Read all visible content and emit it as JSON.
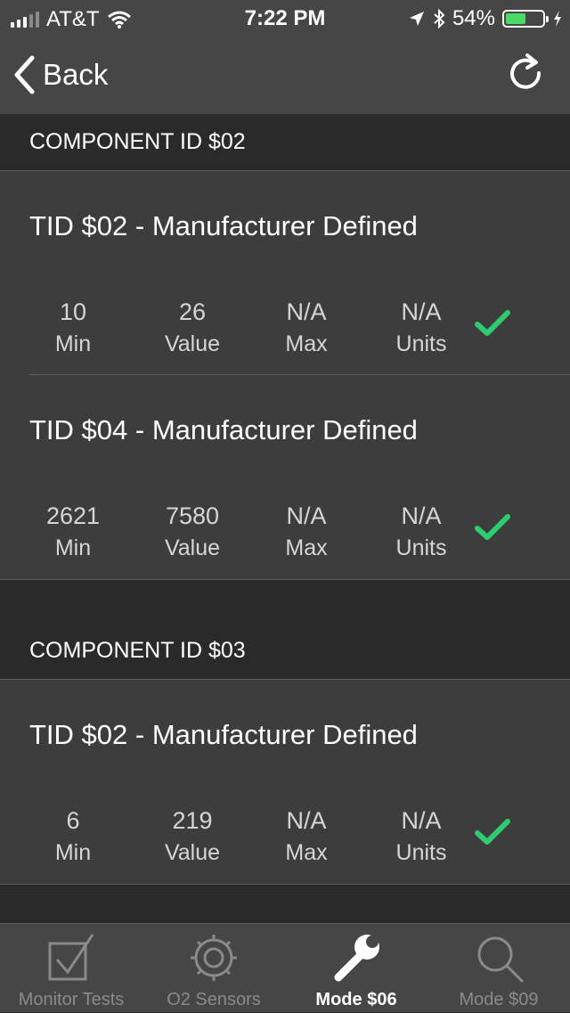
{
  "status_bar": {
    "carrier": "AT&T",
    "time": "7:22 PM",
    "battery_percent": "54%",
    "battery_level": 0.54,
    "icons": [
      "signal-icon",
      "wifi-icon",
      "location-icon",
      "bluetooth-icon",
      "battery-icon",
      "charging-icon"
    ]
  },
  "nav": {
    "back_label": "Back",
    "refresh_icon": "refresh-icon"
  },
  "sections": [
    {
      "title": "COMPONENT ID $02",
      "tests": [
        {
          "title": "TID $02 - Manufacturer Defined",
          "min": "10",
          "value": "26",
          "max": "N/A",
          "units": "N/A",
          "min_label": "Min",
          "value_label": "Value",
          "max_label": "Max",
          "units_label": "Units",
          "passed": true
        },
        {
          "title": "TID $04 - Manufacturer Defined",
          "min": "2621",
          "value": "7580",
          "max": "N/A",
          "units": "N/A",
          "min_label": "Min",
          "value_label": "Value",
          "max_label": "Max",
          "units_label": "Units",
          "passed": true
        }
      ]
    },
    {
      "title": "COMPONENT ID $03",
      "tests": [
        {
          "title": "TID $02 - Manufacturer Defined",
          "min": "6",
          "value": "219",
          "max": "N/A",
          "units": "N/A",
          "min_label": "Min",
          "value_label": "Value",
          "max_label": "Max",
          "units_label": "Units",
          "passed": true
        }
      ]
    }
  ],
  "tabs": [
    {
      "label": "Monitor Tests",
      "icon": "checkbox-icon",
      "active": false
    },
    {
      "label": "O2 Sensors",
      "icon": "gear-icon",
      "active": false
    },
    {
      "label": "Mode $06",
      "icon": "wrench-icon",
      "active": true
    },
    {
      "label": "Mode $09",
      "icon": "magnifier-icon",
      "active": false
    }
  ],
  "colors": {
    "background": "#2a2a2a",
    "bar": "#464646",
    "card": "#3d3d3d",
    "check": "#2ecc71",
    "battery": "#4cd964"
  }
}
